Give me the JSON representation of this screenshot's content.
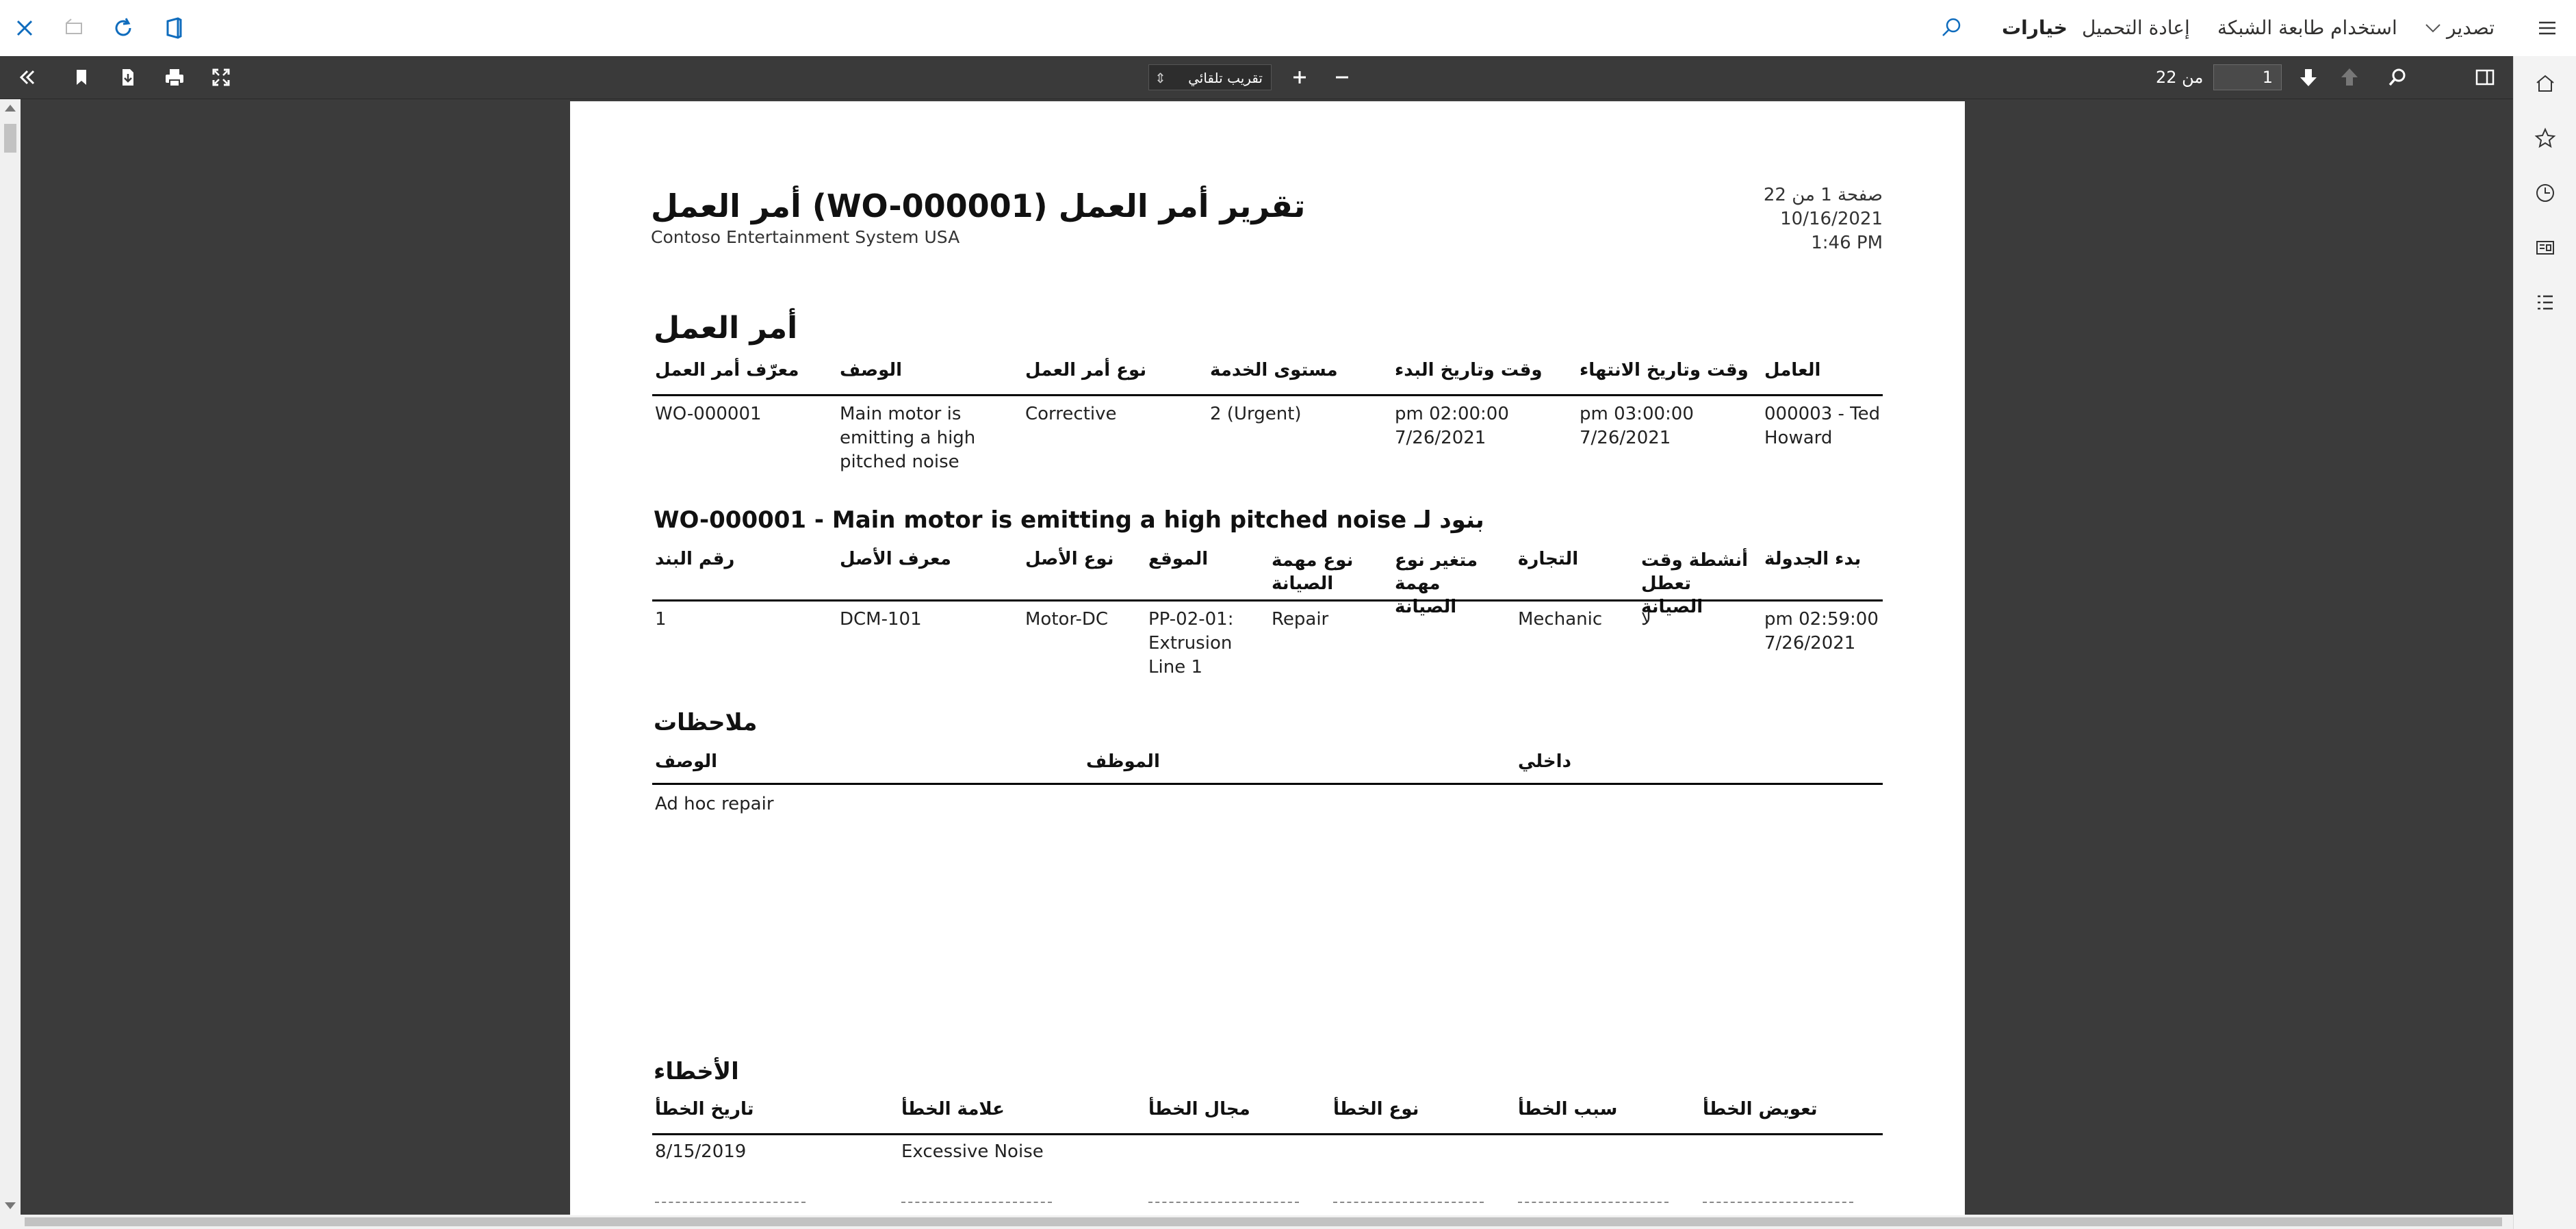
{
  "topbar": {
    "export_label": "تصدير",
    "network_print_label": "استخدام طابعة الشبكة",
    "reload_label": "إعادة التحميل",
    "options_label": "خيارات"
  },
  "viewer_toolbar": {
    "page_number": "1",
    "page_of": "من 22",
    "zoom": "تقريب تلقائي"
  },
  "report": {
    "header": {
      "title": "أمر العمل (WO-000001) تقرير أمر العمل",
      "company": "Contoso Entertainment System USA",
      "page_info": "صفحة 1 من 22",
      "date": "10/16/2021",
      "time": "1:46 PM"
    },
    "work_order": {
      "section_title": "أمر العمل",
      "columns": [
        "معرّف أمر العمل",
        "الوصف",
        "نوع أمر العمل",
        "مستوى الخدمة",
        "وقت وتاريخ البدء",
        "وقت وتاريخ الانتهاء",
        "العامل"
      ],
      "row": [
        "WO-000001",
        "Main motor is emitting a high pitched noise",
        "Corrective",
        "2 (Urgent)",
        "pm 02:00:00 7/26/2021",
        "pm 03:00:00 7/26/2021",
        "000003 - Ted Howard"
      ]
    },
    "lines": {
      "title": "بنود لـ WO-000001 - Main motor is emitting a high pitched noise",
      "columns": [
        "رقم البند",
        "معرف الأصل",
        "نوع الأصل",
        "الموقع",
        "نوع مهمة الصيانة",
        "متغير نوع مهمة الصيانة",
        "التجارة",
        "أنشطة وقت تعطل الصيانة",
        "بدء الجدولة"
      ],
      "row": [
        "1",
        "DCM-101",
        "Motor-DC",
        "PP-02-01: Extrusion Line 1",
        "Repair",
        "",
        "Mechanic",
        "لا",
        "pm 02:59:00 7/26/2021"
      ]
    },
    "notes": {
      "title": "ملاحظات",
      "columns": [
        "الوصف",
        "الموظف",
        "داخلي"
      ],
      "row": [
        "Ad hoc repair",
        "",
        ""
      ]
    },
    "faults": {
      "title": "الأخطاء",
      "columns": [
        "تاريخ الخطأ",
        "علامة الخطأ",
        "مجال الخطأ",
        "نوع الخطأ",
        "سبب الخطأ",
        "تعويض الخطأ"
      ],
      "row": [
        "8/15/2019",
        "Excessive Noise",
        "",
        "",
        "",
        ""
      ]
    }
  },
  "colors": {
    "viewer_bg": "#3b3b3b",
    "toolbar_bg": "#3a3a3a",
    "accent": "#0f6cbd"
  }
}
